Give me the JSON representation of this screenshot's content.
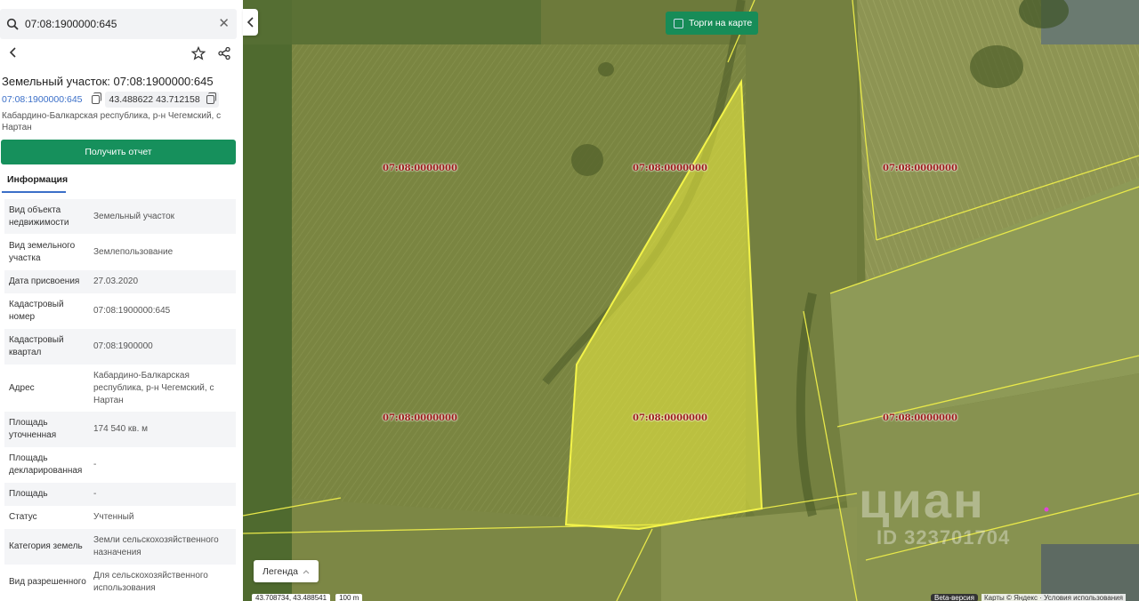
{
  "search": {
    "value": "07:08:1900000:645"
  },
  "parcel": {
    "title": "Земельный участок: 07:08:1900000:645",
    "cadastral_link": "07:08:1900000:645",
    "coords": "43.488622 43.712158",
    "address": "Кабардино-Балкарская республика, р-н Чегемский, с Нартан"
  },
  "actions": {
    "report_label": "Получить отчет"
  },
  "tabs": [
    {
      "label": "Информация"
    }
  ],
  "info_rows": [
    {
      "key": "Вид объекта недвижимости",
      "value": "Земельный участок"
    },
    {
      "key": "Вид земельного участка",
      "value": "Землепользование"
    },
    {
      "key": "Дата присвоения",
      "value": "27.03.2020"
    },
    {
      "key": "Кадастровый номер",
      "value": "07:08:1900000:645"
    },
    {
      "key": "Кадастровый квартал",
      "value": "07:08:1900000"
    },
    {
      "key": "Адрес",
      "value": "Кабардино-Балкарская республика, р-н Чегемский, с Нартан"
    },
    {
      "key": "Площадь уточненная",
      "value": "174 540 кв. м"
    },
    {
      "key": "Площадь декларированная",
      "value": "-"
    },
    {
      "key": "Площадь",
      "value": "-"
    },
    {
      "key": "Статус",
      "value": "Учтенный"
    },
    {
      "key": "Категория земель",
      "value": "Земли сельскохозяйственного назначения"
    },
    {
      "key": "Вид разрешенного",
      "value": "Для сельскохозяйственного использования"
    }
  ],
  "map": {
    "auction_label": "Торги на карте",
    "legend_label": "Легенда",
    "plot_labels": [
      "07:08:0000000",
      "07:08:0000000",
      "07:08:0000000",
      "07:08:0000000",
      "07:08:0000000",
      "07:08:0000000"
    ],
    "coords_readout": "43.708734, 43.488541",
    "scale": "100 m",
    "beta": "Beta-версия",
    "copyright": "Карты © Яндекс · Условия использования",
    "watermark": "циан",
    "watermark_id": "ID 323701704",
    "highlight_color": "#f0f040",
    "boundary_color": "#e8e84a",
    "label_color": "#9c1616"
  }
}
